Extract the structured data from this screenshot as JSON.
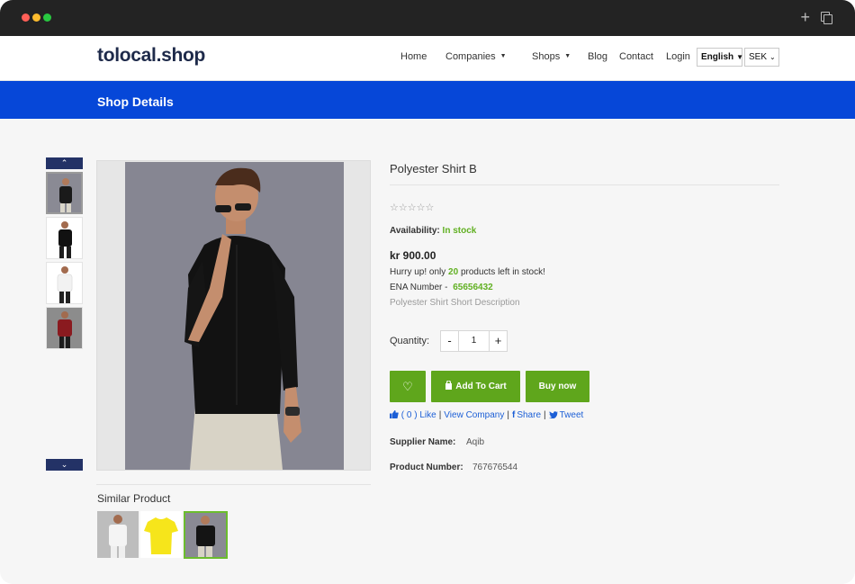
{
  "nav": {
    "logo": "tolocal.shop",
    "links": [
      "Home",
      "Companies",
      "Shops",
      "Blog",
      "Contact",
      "Login"
    ],
    "language": "English",
    "currency": "SEK"
  },
  "banner": {
    "title": "Shop Details"
  },
  "gallery": {
    "thumbnails": [
      {
        "shirt_color": "#1a1a1a",
        "pant_color": "#d9d5c9"
      },
      {
        "shirt_color": "#111111",
        "pant_color": "#1c1c1c"
      },
      {
        "shirt_color": "#f2f2f2",
        "pant_color": "#222222"
      },
      {
        "shirt_color": "#8a1a1f",
        "pant_color": "#1c1c1c"
      }
    ]
  },
  "similar": {
    "title": "Similar Product",
    "items": [
      {
        "kind": "white-shirt"
      },
      {
        "kind": "yellow-tshirt"
      },
      {
        "kind": "black-shirt"
      }
    ]
  },
  "product": {
    "name": "Polyester Shirt B",
    "stars": "☆☆☆☆☆",
    "availability_label": "Availability:",
    "availability_value": "In stock",
    "price": "kr 900.00",
    "hurry_prefix": "Hurry up! only",
    "stock_count": "20",
    "hurry_suffix": "products left in stock!",
    "ena_label": "ENA Number -",
    "ena_value": "65656432",
    "short_description": "Polyester Shirt Short Description",
    "quantity_label": "Quantity:",
    "quantity": "1",
    "minus": "-",
    "plus": "+",
    "wishlist_icon": "♡",
    "add_to_cart": "Add To Cart",
    "buy_now": "Buy now",
    "like_text": "( 0 ) Like",
    "view_company": "View Company",
    "share": "Share",
    "tweet": "Tweet",
    "supplier_label": "Supplier Name:",
    "supplier_value": "Aqib",
    "product_number_label": "Product Number:",
    "product_number_value": "767676544"
  },
  "colors": {
    "banner_blue": "#0647d8",
    "button_green": "#5fa61c",
    "link_blue": "#1c5fd6",
    "accent_green": "#61b022"
  }
}
